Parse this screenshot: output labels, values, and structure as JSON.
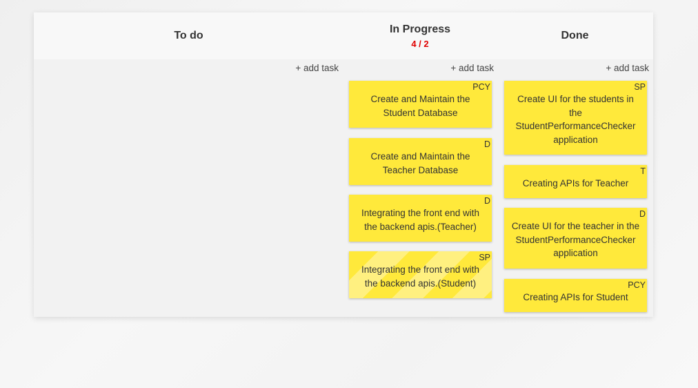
{
  "columns": [
    {
      "title": "To do",
      "wip": "",
      "add_label": "+ add task",
      "cards": []
    },
    {
      "title": "In Progress",
      "wip": "4 / 2",
      "add_label": "+ add task",
      "cards": [
        {
          "tag": "PCY",
          "text": "Create and Maintain the Student Database"
        },
        {
          "tag": "D",
          "text": "Create and Maintain the Teacher Database"
        },
        {
          "tag": "D",
          "text": "Integrating the front end with the backend apis.(Teacher)"
        },
        {
          "tag": "SP",
          "text": "Integrating the front end with the backend apis.(Student)"
        }
      ]
    },
    {
      "title": "Done",
      "wip": "",
      "add_label": "+ add task",
      "cards": [
        {
          "tag": "SP",
          "text": "Create UI for the students in the StudentPerformanceChecker application"
        },
        {
          "tag": "T",
          "text": "Creating APIs for Teacher"
        },
        {
          "tag": "D",
          "text": "Create UI for the teacher in the StudentPerformanceChecker application"
        },
        {
          "tag": "PCY",
          "text": "Creating APIs for Student"
        }
      ]
    }
  ],
  "colors": {
    "card": "#ffe93b",
    "wip_over": "#e00000"
  }
}
